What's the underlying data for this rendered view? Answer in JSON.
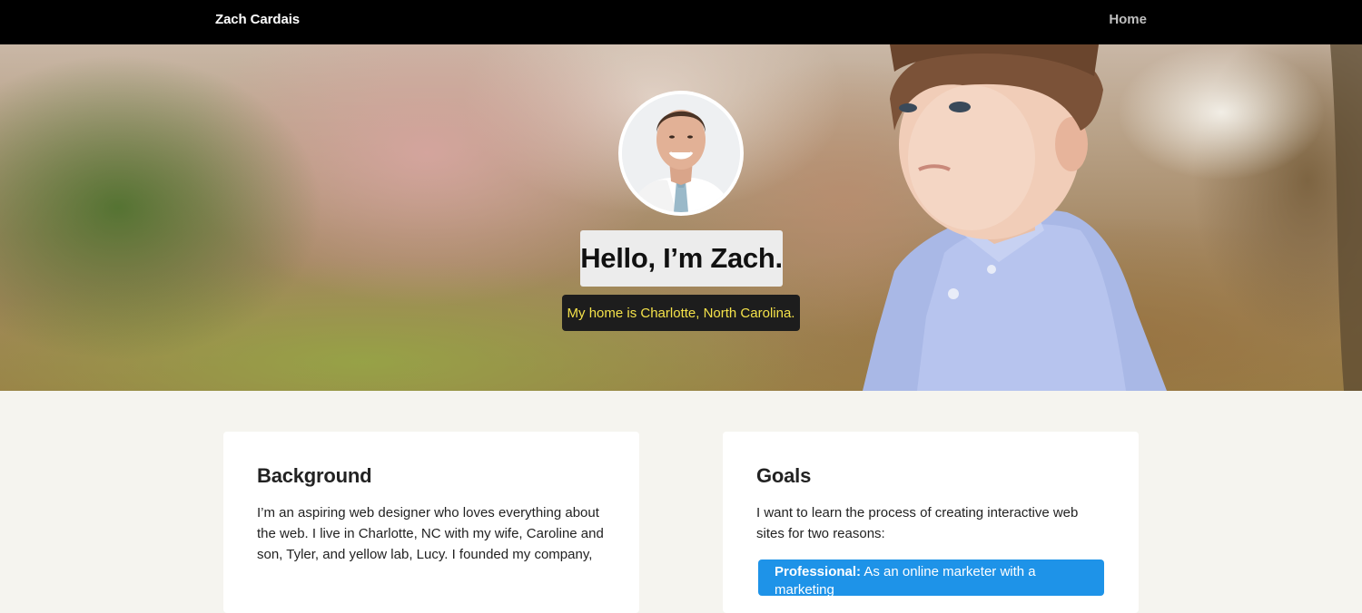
{
  "navbar": {
    "brand": "Zach Cardais",
    "links": [
      {
        "label": "Home"
      }
    ]
  },
  "hero": {
    "headline": "Hello, I’m Zach.",
    "subline": "My home is Charlotte, North Carolina.",
    "colors": {
      "headline_box": "#ececec",
      "subline_box": "#1d1d1d",
      "subline_text": "#f4e24a"
    }
  },
  "background_card": {
    "title": "Background",
    "text": "I’m an aspiring web designer who loves everything about the web. I live in Charlotte, NC with my wife, Caroline and son, Tyler, and yellow lab, Lucy. I founded my company,"
  },
  "goals_card": {
    "title": "Goals",
    "text": "I want to learn the process of creating interactive web sites for two reasons:",
    "callout_label": "Professional:",
    "callout_text": "As an online marketer with a marketing",
    "callout_color": "#1e93e8"
  }
}
